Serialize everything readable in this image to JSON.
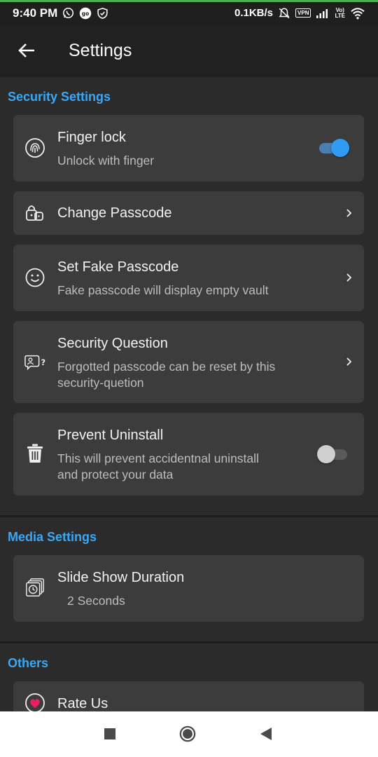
{
  "status_bar": {
    "time": "9:40 PM",
    "speed": "0.1KB/s",
    "vpn": "VPN",
    "volte_top": "Vo)",
    "volte_bottom": "LTE",
    "icons": [
      "whatsapp-icon",
      "go-icon",
      "shield-icon",
      "mute-icon",
      "vpn-icon",
      "signal-icon",
      "volte-icon",
      "wifi-icon"
    ]
  },
  "app_bar": {
    "title": "Settings",
    "back_icon": "arrow-left-icon"
  },
  "sections": {
    "security": {
      "header": "Security Settings",
      "finger_lock": {
        "title": "Finger lock",
        "subtitle": "Unlock with finger",
        "enabled": true,
        "icon": "fingerprint-icon"
      },
      "change_passcode": {
        "title": "Change Passcode",
        "icon": "passcode-lock-icon"
      },
      "fake_passcode": {
        "title": "Set Fake Passcode",
        "subtitle": "Fake passcode will display empty vault",
        "icon": "smiley-icon"
      },
      "security_question": {
        "title": "Security Question",
        "subtitle_line1": "Forgotted passcode can be reset by this",
        "subtitle_line2": "security-quetion",
        "icon": "security-question-icon"
      },
      "prevent_uninstall": {
        "title": "Prevent Uninstall",
        "subtitle_line1": "This will prevent accidentnal uninstall",
        "subtitle_line2": "and protect your data",
        "enabled": false,
        "icon": "trash-icon"
      }
    },
    "media": {
      "header": "Media Settings",
      "slideshow": {
        "title": "Slide Show Duration",
        "value": "2 Seconds",
        "icon": "slideshow-timer-icon"
      }
    },
    "others": {
      "header": "Others",
      "rate_us": {
        "title": "Rate Us",
        "icon": "heart-icon"
      }
    }
  },
  "nav_bar": {
    "buttons": [
      "recents-square-icon",
      "home-circle-icon",
      "back-triangle-icon"
    ]
  },
  "colors": {
    "accent": "#3ba7f5",
    "toggle_on_track": "#4a7fb0",
    "toggle_on_thumb": "#2f9bf2",
    "toggle_off_track": "#5a5a5a",
    "toggle_off_thumb": "#cfcfcf",
    "card_bg": "#3c3c3c",
    "page_bg": "#2b2b2b",
    "heart": "#e91e63"
  }
}
